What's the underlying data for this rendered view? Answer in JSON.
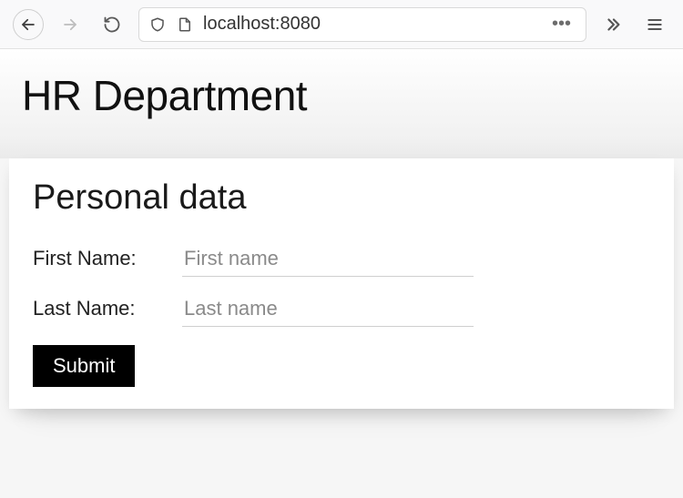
{
  "browser": {
    "url": "localhost:8080"
  },
  "page": {
    "title": "HR Department"
  },
  "form": {
    "heading": "Personal data",
    "first_name_label": "First Name:",
    "first_name_placeholder": "First name",
    "first_name_value": "",
    "last_name_label": "Last Name:",
    "last_name_placeholder": "Last name",
    "last_name_value": "",
    "submit_label": "Submit"
  }
}
